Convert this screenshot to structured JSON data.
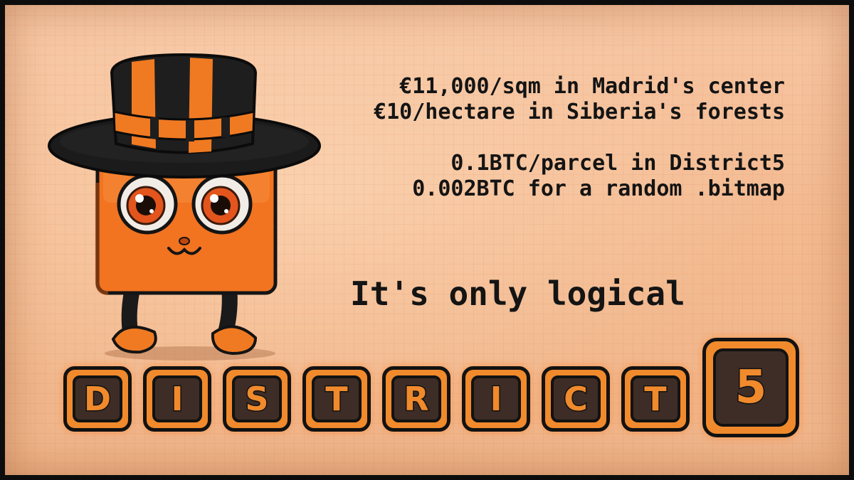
{
  "text": {
    "line1": "€11,000/sqm in Madrid's center",
    "line2": "€10/hectare in Siberia's forests",
    "line3": "0.1BTC/parcel in District5",
    "line4": "0.002BTC for a random .bitmap",
    "tagline": "It's only logical"
  },
  "logo": {
    "letters": [
      "D",
      "I",
      "S",
      "T",
      "R",
      "I",
      "C",
      "T"
    ],
    "number": "5"
  },
  "colors": {
    "background": "#f3b98f",
    "accent_orange": "#f08a2c",
    "dark": "#121212"
  },
  "icons": [
    "mascot-cube-with-top-hat"
  ]
}
